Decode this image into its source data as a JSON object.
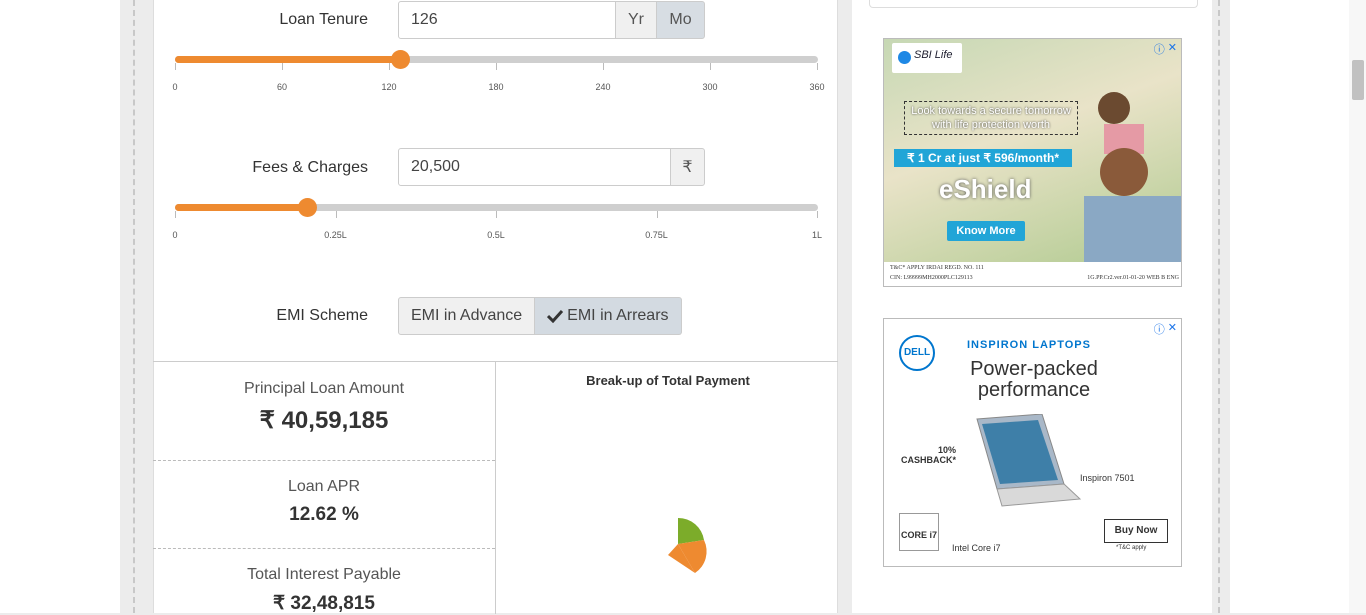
{
  "loan_tenure": {
    "label": "Loan Tenure",
    "value": "126",
    "unit_yr": "Yr",
    "unit_mo": "Mo",
    "active_unit": "Mo",
    "slider_fraction": 0.35,
    "ticks": [
      "0",
      "60",
      "120",
      "180",
      "240",
      "300",
      "360"
    ]
  },
  "fees": {
    "label": "Fees & Charges",
    "value": "20,500",
    "currency": "₹",
    "slider_fraction": 0.205,
    "ticks": [
      "0",
      "0.25L",
      "0.5L",
      "0.75L",
      "1L"
    ]
  },
  "emi_scheme": {
    "label": "EMI Scheme",
    "advance_label": "EMI in Advance",
    "arrears_label": "EMI in Arrears",
    "selected": "EMI in Arrears"
  },
  "results": {
    "principal_title": "Principal Loan Amount",
    "principal_value": "₹ 40,59,185",
    "apr_title": "Loan APR",
    "apr_value": "12.62 %",
    "interest_title": "Total Interest Payable",
    "interest_value": "₹ 32,48,815"
  },
  "chart": {
    "title": "Break-up of Total Payment"
  },
  "ad_sbi": {
    "brand": "SBI Life",
    "headline": "Look towards a secure tomorrow with life protection worth",
    "offer": "₹ 1 Cr at just ₹ 596/month*",
    "product": "eShield",
    "cta": "Know More",
    "footer_left": "T&C* APPLY  IRDAI REGD. NO. 111",
    "footer_cin": "CIN: L99999MH2000PLC129113",
    "footer_right": "1G.PP.Cr2.ver.01-01-20 WEB B ENG"
  },
  "ad_dell": {
    "brand": "DELL",
    "tag": "INSPIRON LAPTOPS",
    "headline": "Power-packed performance",
    "cashback": "10% CASHBACK*",
    "model": "Inspiron 7501",
    "cpu": "Intel Core i7",
    "cpu_badge": "CORE i7",
    "cta": "Buy Now",
    "tc": "*T&C apply"
  },
  "colors": {
    "accent": "#ee8a30",
    "pie_green": "#7cac2a"
  }
}
